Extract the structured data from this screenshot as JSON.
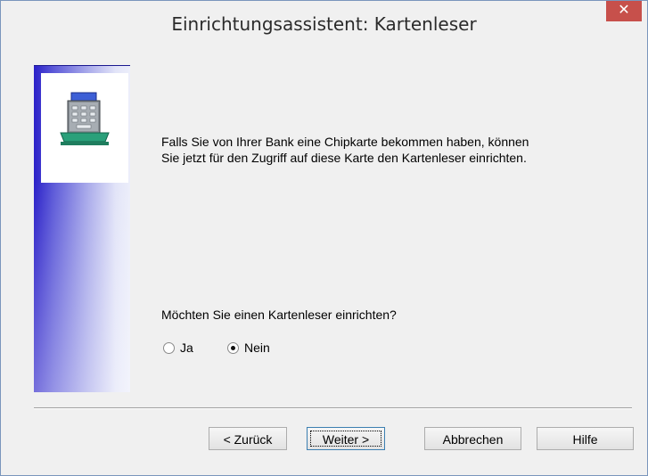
{
  "window": {
    "title": "Einrichtungsassistent: Kartenleser",
    "close_glyph": "✕"
  },
  "banner": {
    "icon": "card-reader-icon"
  },
  "content": {
    "info_line1": "Falls Sie von Ihrer Bank eine Chipkarte bekommen haben, können",
    "info_line2": "Sie jetzt für den Zugriff auf diese Karte den Kartenleser einrichten.",
    "question": "Möchten Sie einen Kartenleser einrichten?",
    "options": [
      {
        "label": "Ja",
        "selected": false
      },
      {
        "label": "Nein",
        "selected": true
      }
    ]
  },
  "buttons": {
    "back": "< Zurück",
    "next": "Weiter >",
    "cancel": "Abbrechen",
    "help": "Hilfe"
  },
  "colors": {
    "close_button": "#c7504b",
    "banner_dark": "#2a20c8",
    "default_button_border": "#3c7fb1"
  }
}
